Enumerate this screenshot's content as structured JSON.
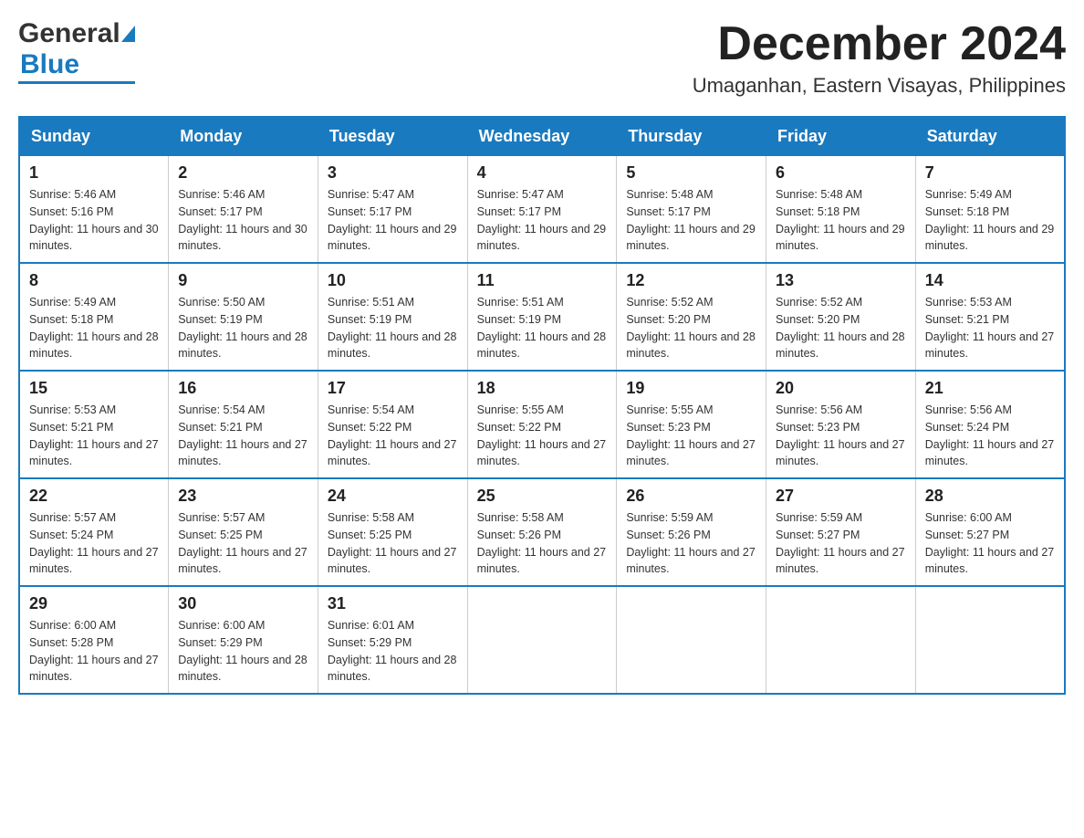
{
  "header": {
    "logo_general": "General",
    "logo_blue": "Blue",
    "month_title": "December 2024",
    "location": "Umaganhan, Eastern Visayas, Philippines"
  },
  "days_of_week": [
    "Sunday",
    "Monday",
    "Tuesday",
    "Wednesday",
    "Thursday",
    "Friday",
    "Saturday"
  ],
  "weeks": [
    [
      {
        "day": "1",
        "sunrise": "5:46 AM",
        "sunset": "5:16 PM",
        "daylight": "11 hours and 30 minutes."
      },
      {
        "day": "2",
        "sunrise": "5:46 AM",
        "sunset": "5:17 PM",
        "daylight": "11 hours and 30 minutes."
      },
      {
        "day": "3",
        "sunrise": "5:47 AM",
        "sunset": "5:17 PM",
        "daylight": "11 hours and 29 minutes."
      },
      {
        "day": "4",
        "sunrise": "5:47 AM",
        "sunset": "5:17 PM",
        "daylight": "11 hours and 29 minutes."
      },
      {
        "day": "5",
        "sunrise": "5:48 AM",
        "sunset": "5:17 PM",
        "daylight": "11 hours and 29 minutes."
      },
      {
        "day": "6",
        "sunrise": "5:48 AM",
        "sunset": "5:18 PM",
        "daylight": "11 hours and 29 minutes."
      },
      {
        "day": "7",
        "sunrise": "5:49 AM",
        "sunset": "5:18 PM",
        "daylight": "11 hours and 29 minutes."
      }
    ],
    [
      {
        "day": "8",
        "sunrise": "5:49 AM",
        "sunset": "5:18 PM",
        "daylight": "11 hours and 28 minutes."
      },
      {
        "day": "9",
        "sunrise": "5:50 AM",
        "sunset": "5:19 PM",
        "daylight": "11 hours and 28 minutes."
      },
      {
        "day": "10",
        "sunrise": "5:51 AM",
        "sunset": "5:19 PM",
        "daylight": "11 hours and 28 minutes."
      },
      {
        "day": "11",
        "sunrise": "5:51 AM",
        "sunset": "5:19 PM",
        "daylight": "11 hours and 28 minutes."
      },
      {
        "day": "12",
        "sunrise": "5:52 AM",
        "sunset": "5:20 PM",
        "daylight": "11 hours and 28 minutes."
      },
      {
        "day": "13",
        "sunrise": "5:52 AM",
        "sunset": "5:20 PM",
        "daylight": "11 hours and 28 minutes."
      },
      {
        "day": "14",
        "sunrise": "5:53 AM",
        "sunset": "5:21 PM",
        "daylight": "11 hours and 27 minutes."
      }
    ],
    [
      {
        "day": "15",
        "sunrise": "5:53 AM",
        "sunset": "5:21 PM",
        "daylight": "11 hours and 27 minutes."
      },
      {
        "day": "16",
        "sunrise": "5:54 AM",
        "sunset": "5:21 PM",
        "daylight": "11 hours and 27 minutes."
      },
      {
        "day": "17",
        "sunrise": "5:54 AM",
        "sunset": "5:22 PM",
        "daylight": "11 hours and 27 minutes."
      },
      {
        "day": "18",
        "sunrise": "5:55 AM",
        "sunset": "5:22 PM",
        "daylight": "11 hours and 27 minutes."
      },
      {
        "day": "19",
        "sunrise": "5:55 AM",
        "sunset": "5:23 PM",
        "daylight": "11 hours and 27 minutes."
      },
      {
        "day": "20",
        "sunrise": "5:56 AM",
        "sunset": "5:23 PM",
        "daylight": "11 hours and 27 minutes."
      },
      {
        "day": "21",
        "sunrise": "5:56 AM",
        "sunset": "5:24 PM",
        "daylight": "11 hours and 27 minutes."
      }
    ],
    [
      {
        "day": "22",
        "sunrise": "5:57 AM",
        "sunset": "5:24 PM",
        "daylight": "11 hours and 27 minutes."
      },
      {
        "day": "23",
        "sunrise": "5:57 AM",
        "sunset": "5:25 PM",
        "daylight": "11 hours and 27 minutes."
      },
      {
        "day": "24",
        "sunrise": "5:58 AM",
        "sunset": "5:25 PM",
        "daylight": "11 hours and 27 minutes."
      },
      {
        "day": "25",
        "sunrise": "5:58 AM",
        "sunset": "5:26 PM",
        "daylight": "11 hours and 27 minutes."
      },
      {
        "day": "26",
        "sunrise": "5:59 AM",
        "sunset": "5:26 PM",
        "daylight": "11 hours and 27 minutes."
      },
      {
        "day": "27",
        "sunrise": "5:59 AM",
        "sunset": "5:27 PM",
        "daylight": "11 hours and 27 minutes."
      },
      {
        "day": "28",
        "sunrise": "6:00 AM",
        "sunset": "5:27 PM",
        "daylight": "11 hours and 27 minutes."
      }
    ],
    [
      {
        "day": "29",
        "sunrise": "6:00 AM",
        "sunset": "5:28 PM",
        "daylight": "11 hours and 27 minutes."
      },
      {
        "day": "30",
        "sunrise": "6:00 AM",
        "sunset": "5:29 PM",
        "daylight": "11 hours and 28 minutes."
      },
      {
        "day": "31",
        "sunrise": "6:01 AM",
        "sunset": "5:29 PM",
        "daylight": "11 hours and 28 minutes."
      },
      null,
      null,
      null,
      null
    ]
  ],
  "labels": {
    "sunrise": "Sunrise:",
    "sunset": "Sunset:",
    "daylight": "Daylight:"
  }
}
